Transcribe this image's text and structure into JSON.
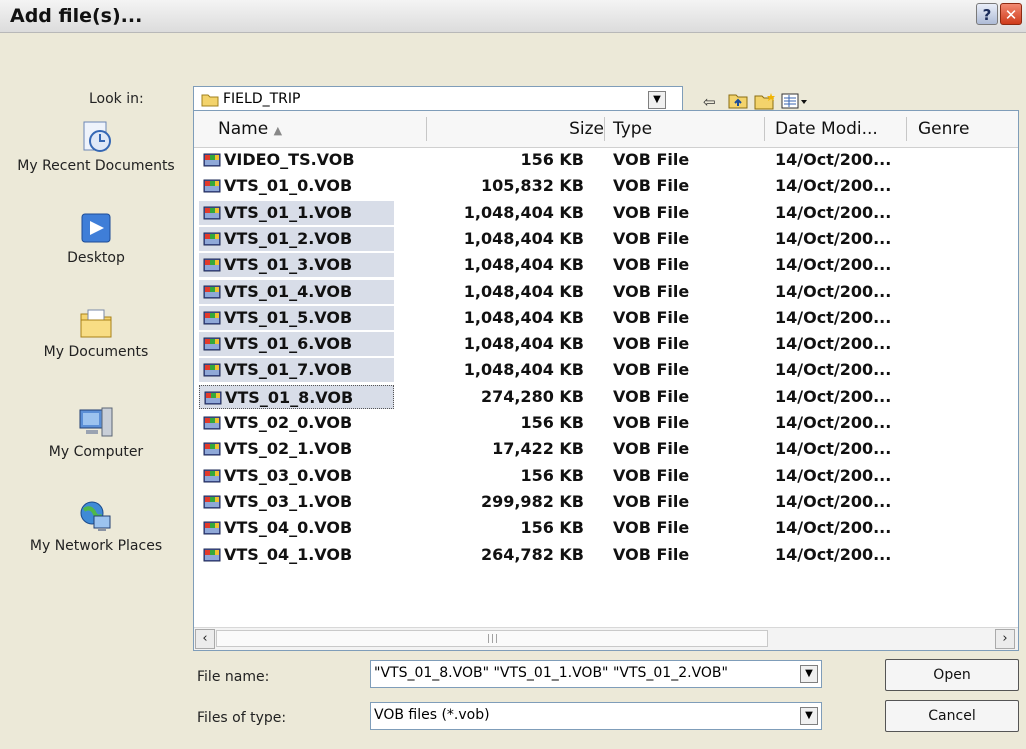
{
  "window": {
    "title": "Add file(s)...",
    "help_label": "?",
    "close_label": "✕"
  },
  "toolbar": {
    "look_in_label": "Look in:",
    "look_in_value": "FIELD_TRIP"
  },
  "places": [
    {
      "label": "My Recent Documents",
      "icon": "recent-documents-icon"
    },
    {
      "label": "Desktop",
      "icon": "desktop-icon"
    },
    {
      "label": "My Documents",
      "icon": "my-documents-icon"
    },
    {
      "label": "My Computer",
      "icon": "my-computer-icon"
    },
    {
      "label": "My Network Places",
      "icon": "network-places-icon"
    }
  ],
  "columns": {
    "name": "Name",
    "size": "Size",
    "type": "Type",
    "date": "Date Modi...",
    "genre": "Genre"
  },
  "files": [
    {
      "name": "VIDEO_TS.VOB",
      "size": "156 KB",
      "type": "VOB File",
      "date": "14/Oct/200...",
      "selected": false
    },
    {
      "name": "VTS_01_0.VOB",
      "size": "105,832 KB",
      "type": "VOB File",
      "date": "14/Oct/200...",
      "selected": false
    },
    {
      "name": "VTS_01_1.VOB",
      "size": "1,048,404 KB",
      "type": "VOB File",
      "date": "14/Oct/200...",
      "selected": true
    },
    {
      "name": "VTS_01_2.VOB",
      "size": "1,048,404 KB",
      "type": "VOB File",
      "date": "14/Oct/200...",
      "selected": true
    },
    {
      "name": "VTS_01_3.VOB",
      "size": "1,048,404 KB",
      "type": "VOB File",
      "date": "14/Oct/200...",
      "selected": true
    },
    {
      "name": "VTS_01_4.VOB",
      "size": "1,048,404 KB",
      "type": "VOB File",
      "date": "14/Oct/200...",
      "selected": true
    },
    {
      "name": "VTS_01_5.VOB",
      "size": "1,048,404 KB",
      "type": "VOB File",
      "date": "14/Oct/200...",
      "selected": true
    },
    {
      "name": "VTS_01_6.VOB",
      "size": "1,048,404 KB",
      "type": "VOB File",
      "date": "14/Oct/200...",
      "selected": true
    },
    {
      "name": "VTS_01_7.VOB",
      "size": "1,048,404 KB",
      "type": "VOB File",
      "date": "14/Oct/200...",
      "selected": true
    },
    {
      "name": "VTS_01_8.VOB",
      "size": "274,280 KB",
      "type": "VOB File",
      "date": "14/Oct/200...",
      "selected": true
    },
    {
      "name": "VTS_02_0.VOB",
      "size": "156 KB",
      "type": "VOB File",
      "date": "14/Oct/200...",
      "selected": false
    },
    {
      "name": "VTS_02_1.VOB",
      "size": "17,422 KB",
      "type": "VOB File",
      "date": "14/Oct/200...",
      "selected": false
    },
    {
      "name": "VTS_03_0.VOB",
      "size": "156 KB",
      "type": "VOB File",
      "date": "14/Oct/200...",
      "selected": false
    },
    {
      "name": "VTS_03_1.VOB",
      "size": "299,982 KB",
      "type": "VOB File",
      "date": "14/Oct/200...",
      "selected": false
    },
    {
      "name": "VTS_04_0.VOB",
      "size": "156 KB",
      "type": "VOB File",
      "date": "14/Oct/200...",
      "selected": false
    },
    {
      "name": "VTS_04_1.VOB",
      "size": "264,782 KB",
      "type": "VOB File",
      "date": "14/Oct/200...",
      "selected": false
    }
  ],
  "focused_file": "VTS_01_8.VOB",
  "footer": {
    "file_name_label": "File name:",
    "file_name_value": "\"VTS_01_8.VOB\" \"VTS_01_1.VOB\" \"VTS_01_2.VOB\"",
    "file_type_label": "Files of type:",
    "file_type_value": "VOB files (*.vob)",
    "open_label": "Open",
    "cancel_label": "Cancel"
  },
  "colors": {
    "dialog_bg": "#ece9d8",
    "selection": "#d8dde8",
    "field_border": "#7f9db9"
  }
}
